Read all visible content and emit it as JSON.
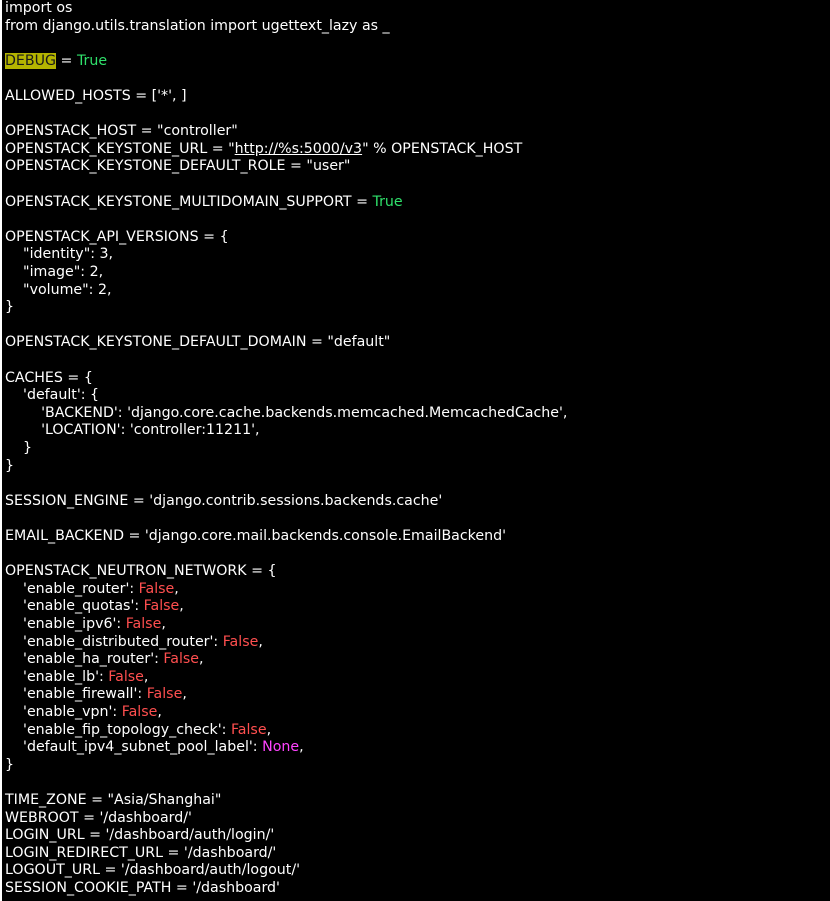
{
  "editor": {
    "theme": {
      "background": "#000000",
      "text": "#ffffff",
      "keyword_true": "#2fe16b",
      "keyword_false": "#ff4f4f",
      "keyword_none": "#ff43ff",
      "search_highlight": "#b4b400"
    },
    "lines": [
      [
        {
          "t": "import os",
          "c": "text"
        }
      ],
      [
        {
          "t": "from django.utils.translation import ugettext_lazy as _",
          "c": "text"
        }
      ],
      [],
      [
        {
          "t": "DEBUG",
          "c": "highlight"
        },
        {
          "t": " = ",
          "c": "text"
        },
        {
          "t": "True",
          "c": "true"
        }
      ],
      [],
      [
        {
          "t": "ALLOWED_HOSTS = ['*', ]",
          "c": "text"
        }
      ],
      [],
      [
        {
          "t": "OPENSTACK_HOST = \"controller\"",
          "c": "text"
        }
      ],
      [
        {
          "t": "OPENSTACK_KEYSTONE_URL = \"",
          "c": "text"
        },
        {
          "t": "http://%s:5000/v3",
          "c": "link"
        },
        {
          "t": "\" % OPENSTACK_HOST",
          "c": "text"
        }
      ],
      [
        {
          "t": "OPENSTACK_KEYSTONE_DEFAULT_ROLE = \"user\"",
          "c": "text"
        }
      ],
      [],
      [
        {
          "t": "OPENSTACK_KEYSTONE_MULTIDOMAIN_SUPPORT = ",
          "c": "text"
        },
        {
          "t": "True",
          "c": "true"
        }
      ],
      [],
      [
        {
          "t": "OPENSTACK_API_VERSIONS = {",
          "c": "text"
        }
      ],
      [
        {
          "t": "    \"identity\": 3,",
          "c": "text"
        }
      ],
      [
        {
          "t": "    \"image\": 2,",
          "c": "text"
        }
      ],
      [
        {
          "t": "    \"volume\": 2,",
          "c": "text"
        }
      ],
      [
        {
          "t": "}",
          "c": "text"
        }
      ],
      [],
      [
        {
          "t": "OPENSTACK_KEYSTONE_DEFAULT_DOMAIN = \"default\"",
          "c": "text"
        }
      ],
      [],
      [
        {
          "t": "CACHES = {",
          "c": "text"
        }
      ],
      [
        {
          "t": "    'default': {",
          "c": "text"
        }
      ],
      [
        {
          "t": "        'BACKEND': 'django.core.cache.backends.memcached.MemcachedCache',",
          "c": "text"
        }
      ],
      [
        {
          "t": "        'LOCATION': 'controller:11211',",
          "c": "text"
        }
      ],
      [
        {
          "t": "    }",
          "c": "text"
        }
      ],
      [
        {
          "t": "}",
          "c": "text"
        }
      ],
      [],
      [
        {
          "t": "SESSION_ENGINE = 'django.contrib.sessions.backends.cache'",
          "c": "text"
        }
      ],
      [],
      [
        {
          "t": "EMAIL_BACKEND = 'django.core.mail.backends.console.EmailBackend'",
          "c": "text"
        }
      ],
      [],
      [
        {
          "t": "OPENSTACK_NEUTRON_NETWORK = {",
          "c": "text"
        }
      ],
      [
        {
          "t": "    'enable_router': ",
          "c": "text"
        },
        {
          "t": "False",
          "c": "false"
        },
        {
          "t": ",",
          "c": "text"
        }
      ],
      [
        {
          "t": "    'enable_quotas': ",
          "c": "text"
        },
        {
          "t": "False",
          "c": "false"
        },
        {
          "t": ",",
          "c": "text"
        }
      ],
      [
        {
          "t": "    'enable_ipv6': ",
          "c": "text"
        },
        {
          "t": "False",
          "c": "false"
        },
        {
          "t": ",",
          "c": "text"
        }
      ],
      [
        {
          "t": "    'enable_distributed_router': ",
          "c": "text"
        },
        {
          "t": "False",
          "c": "false"
        },
        {
          "t": ",",
          "c": "text"
        }
      ],
      [
        {
          "t": "    'enable_ha_router': ",
          "c": "text"
        },
        {
          "t": "False",
          "c": "false"
        },
        {
          "t": ",",
          "c": "text"
        }
      ],
      [
        {
          "t": "    'enable_lb': ",
          "c": "text"
        },
        {
          "t": "False",
          "c": "false"
        },
        {
          "t": ",",
          "c": "text"
        }
      ],
      [
        {
          "t": "    'enable_firewall': ",
          "c": "text"
        },
        {
          "t": "False",
          "c": "false"
        },
        {
          "t": ",",
          "c": "text"
        }
      ],
      [
        {
          "t": "    'enable_vpn': ",
          "c": "text"
        },
        {
          "t": "False",
          "c": "false"
        },
        {
          "t": ",",
          "c": "text"
        }
      ],
      [
        {
          "t": "    'enable_fip_topology_check': ",
          "c": "text"
        },
        {
          "t": "False",
          "c": "false"
        },
        {
          "t": ",",
          "c": "text"
        }
      ],
      [
        {
          "t": "    'default_ipv4_subnet_pool_label': ",
          "c": "text"
        },
        {
          "t": "None",
          "c": "none"
        },
        {
          "t": ",",
          "c": "text"
        }
      ],
      [
        {
          "t": "}",
          "c": "text"
        }
      ],
      [],
      [
        {
          "t": "TIME_ZONE = \"Asia/Shanghai\"",
          "c": "text"
        }
      ],
      [
        {
          "t": "WEBROOT = '/dashboard/'",
          "c": "text"
        }
      ],
      [
        {
          "t": "LOGIN_URL = '/dashboard/auth/login/'",
          "c": "text"
        }
      ],
      [
        {
          "t": "LOGIN_REDIRECT_URL = '/dashboard/'",
          "c": "text"
        }
      ],
      [
        {
          "t": "LOGOUT_URL = '/dashboard/auth/logout/'",
          "c": "text"
        }
      ],
      [
        {
          "t": "SESSION_COOKIE_PATH = '/dashboard'",
          "c": "text"
        }
      ]
    ]
  }
}
